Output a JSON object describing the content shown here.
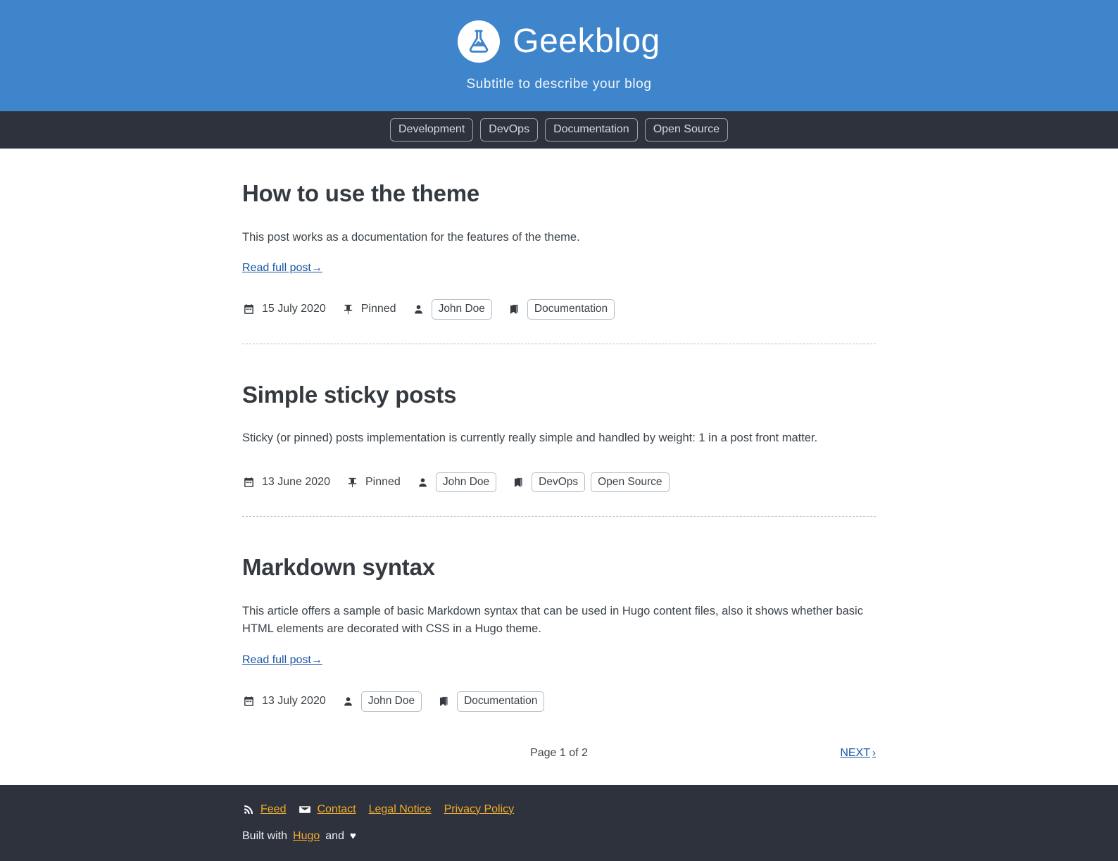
{
  "theme": {
    "header_bg": "#3f85cc",
    "nav_bg": "#2d323c",
    "footer_bg": "#2d323c",
    "link_color": "#1a56a5",
    "footer_link_color": "#f0ad2e",
    "text_color": "#3c4349"
  },
  "header": {
    "logo_icon": "flask-icon",
    "title": "Geekblog",
    "subtitle": "Subtitle to describe your blog"
  },
  "nav": {
    "items": [
      {
        "label": "Development"
      },
      {
        "label": "DevOps"
      },
      {
        "label": "Documentation"
      },
      {
        "label": "Open Source"
      }
    ]
  },
  "posts": [
    {
      "title": "How to use the theme",
      "summary": "This post works as a documentation for the features of the theme.",
      "read_more": "Read full post→",
      "has_read_more": true,
      "date": "15 July 2020",
      "pinned_label": "Pinned",
      "is_pinned": true,
      "author": "John Doe",
      "tags": [
        "Documentation"
      ]
    },
    {
      "title": "Simple sticky posts",
      "summary": "Sticky (or pinned) posts implementation is currently really simple and handled by weight: 1 in a post front matter.",
      "read_more": "",
      "has_read_more": false,
      "date": "13 June 2020",
      "pinned_label": "Pinned",
      "is_pinned": true,
      "author": "John Doe",
      "tags": [
        "DevOps",
        "Open Source"
      ]
    },
    {
      "title": "Markdown syntax",
      "summary": "This article offers a sample of basic Markdown syntax that can be used in Hugo content files, also it shows whether basic HTML elements are decorated with CSS in a Hugo theme.",
      "read_more": "Read full post→",
      "has_read_more": true,
      "date": "13 July 2020",
      "pinned_label": "",
      "is_pinned": false,
      "author": "John Doe",
      "tags": [
        "Documentation"
      ]
    }
  ],
  "pagination": {
    "count_label": "Page 1 of 2",
    "next_label": "NEXT",
    "next_chevron": "›"
  },
  "footer": {
    "links": [
      {
        "label": "Feed",
        "icon": "rss-icon"
      },
      {
        "label": "Contact",
        "icon": "envelope-icon"
      },
      {
        "label": "Legal Notice",
        "icon": ""
      },
      {
        "label": "Privacy Policy",
        "icon": ""
      }
    ],
    "built_prefix": "Built with",
    "built_link": "Hugo",
    "built_suffix": "and",
    "heart": "♥"
  }
}
